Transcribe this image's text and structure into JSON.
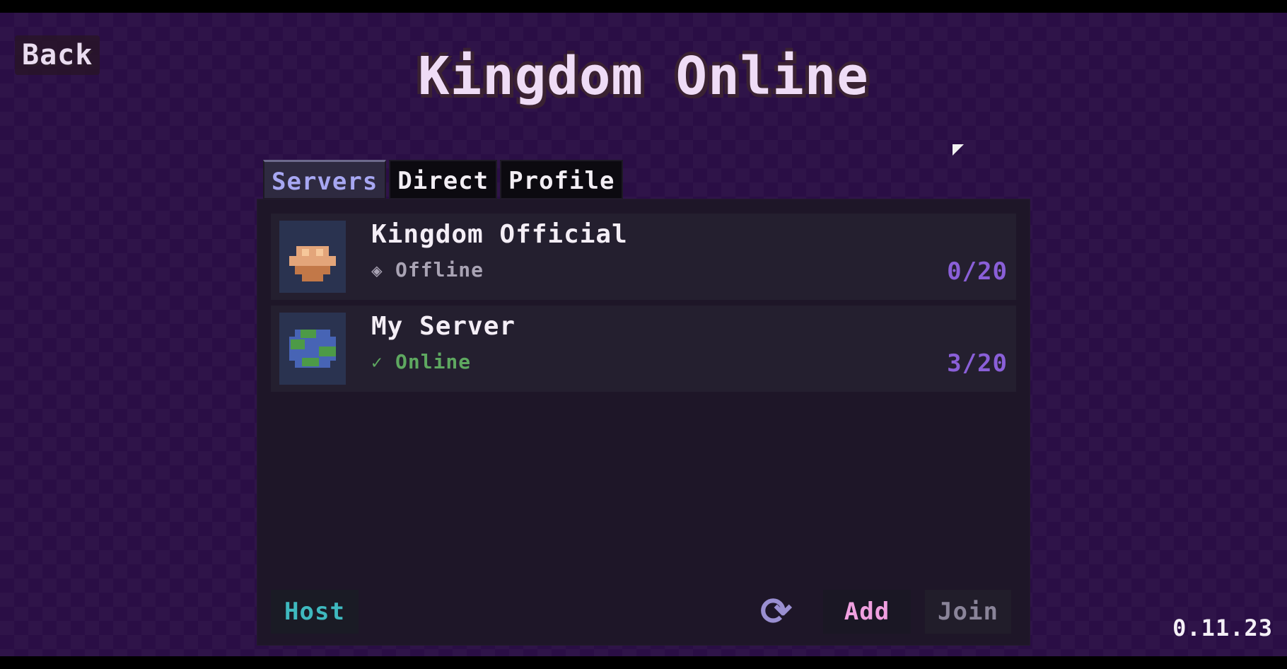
{
  "header": {
    "back_label": "Back",
    "title": "Kingdom Online"
  },
  "tabs": [
    {
      "label": "Servers",
      "active": true
    },
    {
      "label": "Direct",
      "active": false
    },
    {
      "label": "Profile",
      "active": false
    }
  ],
  "servers": [
    {
      "name": "Kingdom Official",
      "status": "Offline",
      "status_icon": "diamond-dots-icon",
      "players": "0/20",
      "icon": "mushroom-icon"
    },
    {
      "name": "My Server",
      "status": "Online",
      "status_icon": "check-icon",
      "players": "3/20",
      "icon": "earth-icon"
    }
  ],
  "footer": {
    "host_label": "Host",
    "refresh_icon": "refresh-icon",
    "add_label": "Add",
    "join_label": "Join"
  },
  "version": "0.11.23",
  "colors": {
    "background": "#2a0e45",
    "panel": "#1e1628",
    "active_tab_text": "#a7a7f2",
    "player_count": "#8a5fd8",
    "online": "#5ea860",
    "host": "#3fb9bf",
    "add": "#f0a0e0"
  }
}
